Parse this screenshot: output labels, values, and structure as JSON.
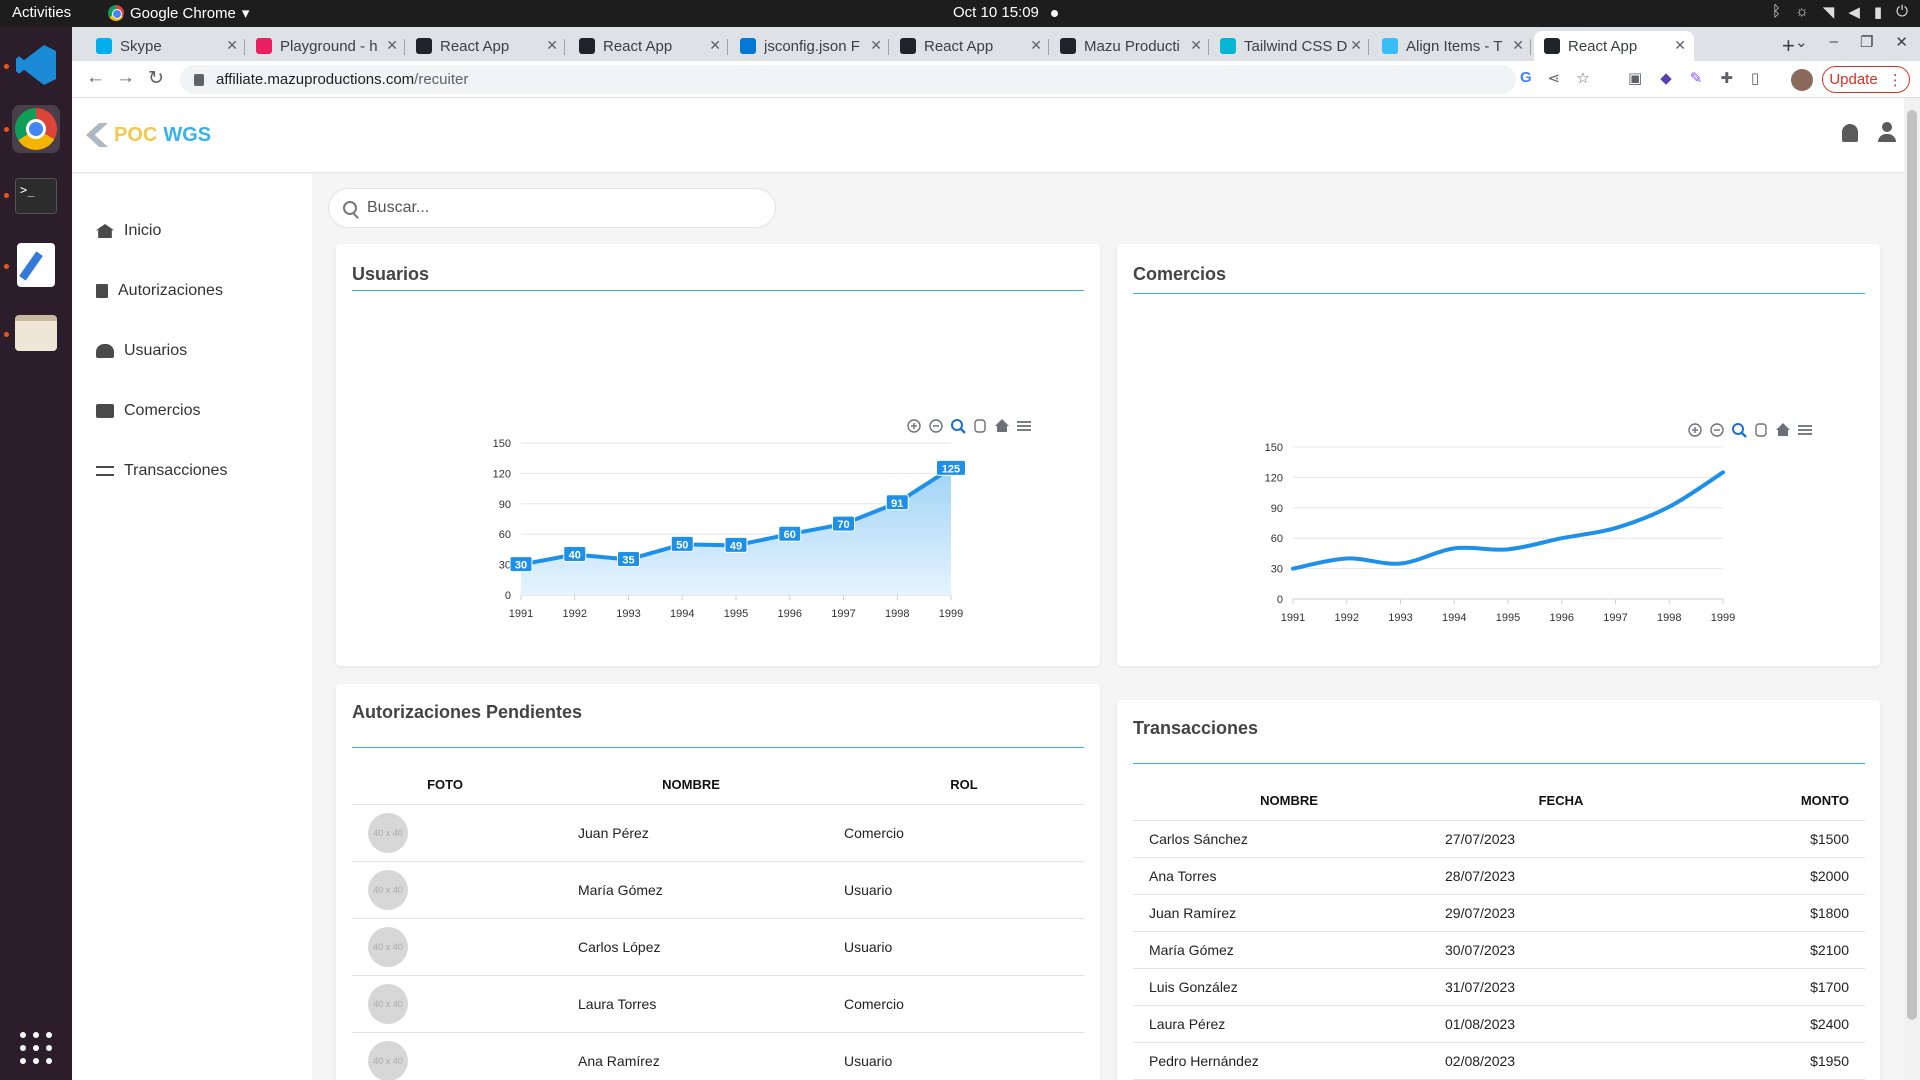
{
  "system": {
    "activities": "Activities",
    "app_menu": "Google Chrome",
    "clock": "Oct 10  15:09"
  },
  "tabs": [
    {
      "label": "Skype",
      "color": "#00aff0"
    },
    {
      "label": "Playground - h",
      "color": "#e91e63"
    },
    {
      "label": "React App",
      "color": "#20232a"
    },
    {
      "label": "React App",
      "color": "#20232a"
    },
    {
      "label": "jsconfig.json F",
      "color": "#0078d4"
    },
    {
      "label": "React App",
      "color": "#20232a"
    },
    {
      "label": "Mazu Producti",
      "color": "#20232a"
    },
    {
      "label": "Tailwind CSS D",
      "color": "#06b6d4"
    },
    {
      "label": "Align Items - T",
      "color": "#38bdf8"
    },
    {
      "label": "React App",
      "color": "#20232a"
    }
  ],
  "address": {
    "domain": "affiliate.mazuproductions.com",
    "path": "/recuiter"
  },
  "update_label": "Update",
  "app": {
    "logo_part1": "POC",
    "logo_part2": "WGS"
  },
  "sidebar": {
    "items": [
      {
        "label": "Inicio",
        "icon": "home-icon"
      },
      {
        "label": "Autorizaciones",
        "icon": "document-icon"
      },
      {
        "label": "Usuarios",
        "icon": "users-icon"
      },
      {
        "label": "Comercios",
        "icon": "store-icon"
      },
      {
        "label": "Transacciones",
        "icon": "swap-icon"
      }
    ]
  },
  "search": {
    "placeholder": "Buscar..."
  },
  "cards": {
    "usuarios_title": "Usuarios",
    "comercios_title": "Comercios",
    "autorizaciones_title": "Autorizaciones Pendientes",
    "transacciones_title": "Transacciones"
  },
  "colors": {
    "accent": "#2fb8c9",
    "series": "#1e90e8",
    "area_top": "#9fd3f6",
    "area_bottom": "#e6f4fd"
  },
  "chart_data": [
    {
      "type": "area",
      "title": "",
      "categories": [
        "1991",
        "1992",
        "1993",
        "1994",
        "1995",
        "1996",
        "1997",
        "1998",
        "1999"
      ],
      "values": [
        30,
        40,
        35,
        50,
        49,
        60,
        70,
        91,
        125
      ],
      "data_labels": true,
      "ylim": [
        0,
        150
      ],
      "yticks": [
        "0",
        "30",
        "60",
        "90",
        "120",
        "150"
      ],
      "grid": true
    },
    {
      "type": "line",
      "title": "",
      "categories": [
        "1991",
        "1992",
        "1993",
        "1994",
        "1995",
        "1996",
        "1997",
        "1998",
        "1999"
      ],
      "values": [
        30,
        40,
        35,
        50,
        49,
        60,
        70,
        91,
        125
      ],
      "data_labels": false,
      "ylim": [
        0,
        150
      ],
      "yticks": [
        "0",
        "30",
        "60",
        "90",
        "120",
        "150"
      ],
      "grid": true
    }
  ],
  "authorizations": {
    "headers": [
      "FOTO",
      "NOMBRE",
      "ROL"
    ],
    "photo_placeholder": "40 x 40",
    "rows": [
      {
        "name": "Juan Pérez",
        "role": "Comercio"
      },
      {
        "name": "María Gómez",
        "role": "Usuario"
      },
      {
        "name": "Carlos López",
        "role": "Usuario"
      },
      {
        "name": "Laura Torres",
        "role": "Comercio"
      },
      {
        "name": "Ana Ramírez",
        "role": "Usuario"
      }
    ]
  },
  "transactions": {
    "headers": [
      "NOMBRE",
      "FECHA",
      "MONTO"
    ],
    "rows": [
      {
        "name": "Carlos Sánchez",
        "date": "27/07/2023",
        "amount": "$1500"
      },
      {
        "name": "Ana Torres",
        "date": "28/07/2023",
        "amount": "$2000"
      },
      {
        "name": "Juan Ramírez",
        "date": "29/07/2023",
        "amount": "$1800"
      },
      {
        "name": "María Gómez",
        "date": "30/07/2023",
        "amount": "$2100"
      },
      {
        "name": "Luis González",
        "date": "31/07/2023",
        "amount": "$1700"
      },
      {
        "name": "Laura Pérez",
        "date": "01/08/2023",
        "amount": "$2400"
      },
      {
        "name": "Pedro Hernández",
        "date": "02/08/2023",
        "amount": "$1950"
      }
    ]
  }
}
